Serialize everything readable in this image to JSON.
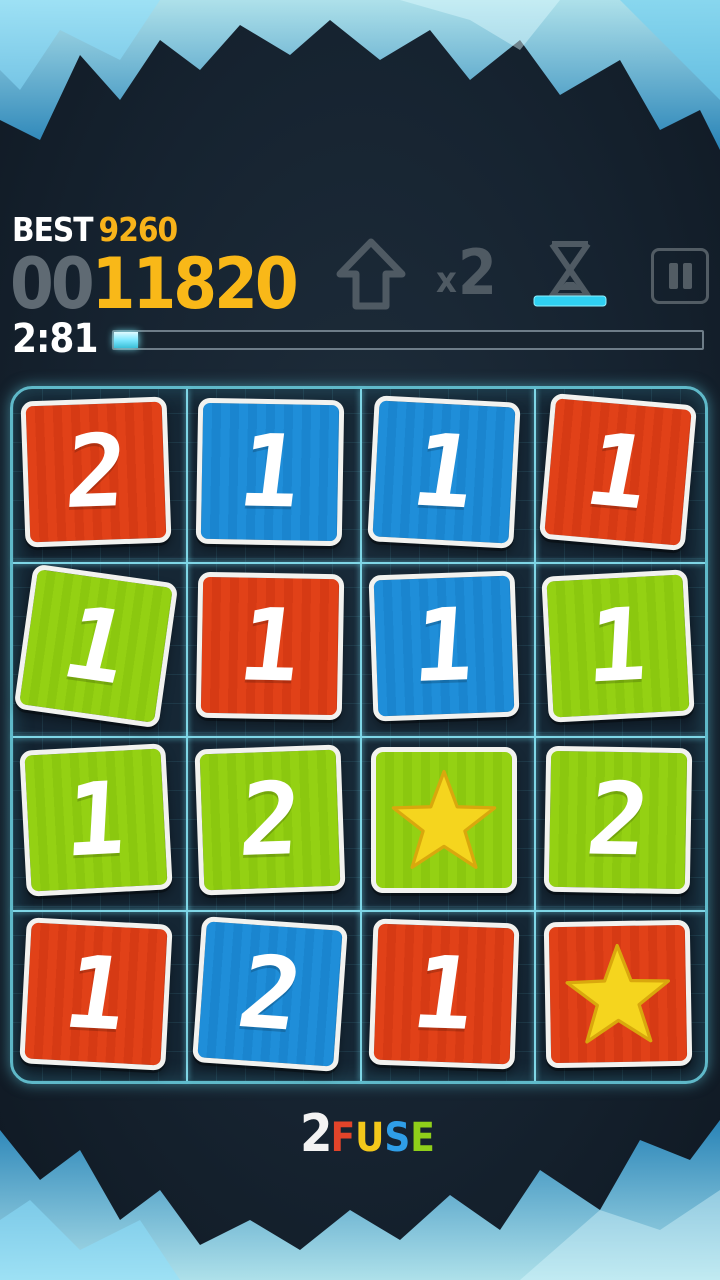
{
  "hud": {
    "best_label": "BEST",
    "best_value": "9260",
    "score_zeros": "00",
    "score_value": "11820",
    "timer": "2:81",
    "time_progress": 0.04
  },
  "powerups": {
    "multiplier_x": "x",
    "multiplier_n": "2"
  },
  "board": {
    "rows": 4,
    "cols": 4,
    "tiles": [
      {
        "color": "red",
        "value": "2",
        "rot": -2
      },
      {
        "color": "blue",
        "value": "1",
        "rot": 1
      },
      {
        "color": "blue",
        "value": "1",
        "rot": 3
      },
      {
        "color": "red",
        "value": "1",
        "rot": 5
      },
      {
        "color": "green",
        "value": "1",
        "rot": 8
      },
      {
        "color": "red",
        "value": "1",
        "rot": 1
      },
      {
        "color": "blue",
        "value": "1",
        "rot": -2
      },
      {
        "color": "green",
        "value": "1",
        "rot": -3
      },
      {
        "color": "green",
        "value": "1",
        "rot": -3
      },
      {
        "color": "green",
        "value": "2",
        "rot": -2
      },
      {
        "color": "green",
        "value": "star",
        "rot": 0
      },
      {
        "color": "green",
        "value": "2",
        "rot": 1
      },
      {
        "color": "red",
        "value": "1",
        "rot": 3
      },
      {
        "color": "blue",
        "value": "2",
        "rot": 4
      },
      {
        "color": "red",
        "value": "1",
        "rot": 2
      },
      {
        "color": "red",
        "value": "star",
        "rot": -1
      }
    ]
  },
  "logo": {
    "two": "2",
    "fuse_letters": [
      {
        "ch": "F",
        "color": "#e2442a"
      },
      {
        "ch": "U",
        "color": "#f3c81b"
      },
      {
        "ch": "S",
        "color": "#2f9ee8"
      },
      {
        "ch": "E",
        "color": "#8fcf1a"
      }
    ]
  },
  "colors": {
    "red": "#e14118",
    "blue": "#1f8ed9",
    "green": "#94d113",
    "accent_gold": "#f9b818",
    "glow_cyan": "#5fd8ee"
  }
}
